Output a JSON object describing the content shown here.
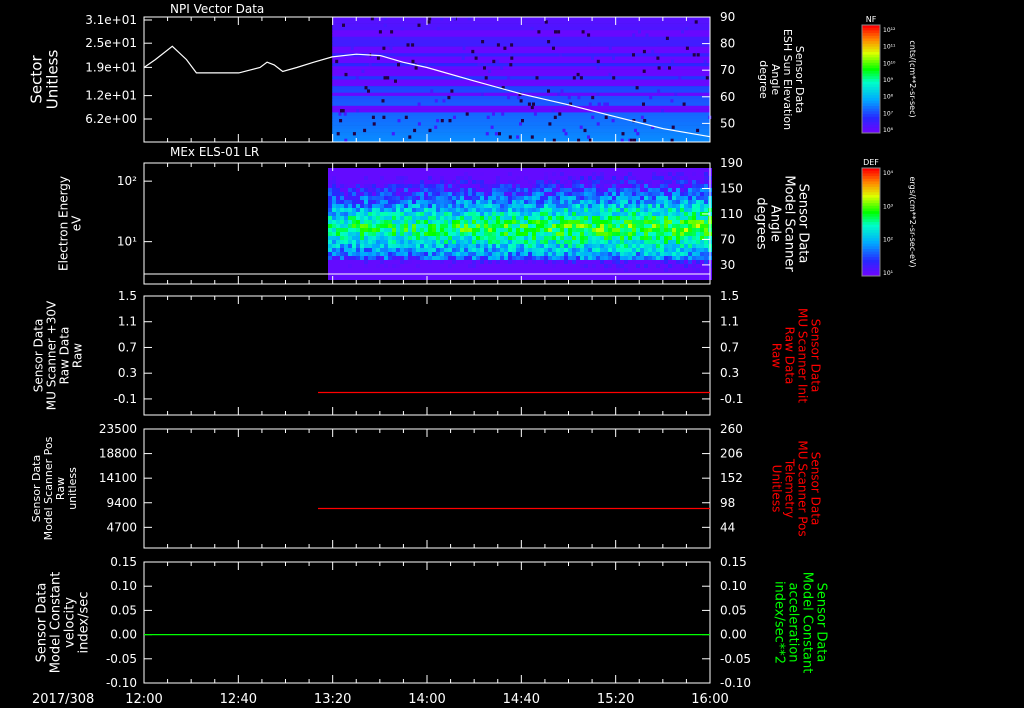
{
  "colors": {
    "background": "#000000",
    "foreground": "#ffffff",
    "red": "#ff0000",
    "green": "#00ff00"
  },
  "time_axis": {
    "date_label": "2017/308",
    "ticks": [
      "12:00",
      "12:40",
      "13:20",
      "14:00",
      "14:40",
      "15:20",
      "16:00"
    ],
    "tick_hours": [
      12.0,
      12.6667,
      13.3333,
      14.0,
      14.6667,
      15.3333,
      16.0
    ]
  },
  "colorbars": [
    {
      "label": "NF",
      "units": "cnts/(cm**2-sr-sec)",
      "tick_labels": [
        "10¹²",
        "10¹¹",
        "10¹⁰",
        "10⁹",
        "10⁸",
        "10⁷",
        "10⁶"
      ]
    },
    {
      "label": "DEF",
      "units": "ergs/(cm**2-sr-sec-eV)",
      "tick_labels": [
        "10⁴",
        "10³",
        "10²",
        "10¹"
      ]
    }
  ],
  "chart_data": [
    {
      "type": "heatmap",
      "title": "NPI Vector Data",
      "ylabel": "Sector\nUnitless",
      "yticks": [
        "3.1e+01",
        "2.5e+01",
        "1.9e+01",
        "1.2e+01",
        "6.2e+00"
      ],
      "ylim": [
        0,
        31
      ],
      "data_start_hour": 13.33,
      "right_ylabel": "Sensor Data\nESH Sun Elevation\nAngle\ndegree",
      "right_yticks": [
        90,
        80,
        70,
        60,
        50
      ],
      "right_ylim": [
        43,
        90
      ],
      "overlay_line": {
        "x_hours": [
          12.0,
          12.08,
          12.2,
          12.3,
          12.37,
          12.47,
          12.67,
          12.82,
          12.87,
          12.92,
          12.98,
          13.08,
          13.2,
          13.33,
          13.5,
          13.67,
          13.83,
          14.0,
          14.33,
          14.67,
          15.0,
          15.33,
          15.67,
          16.0
        ],
        "y": [
          71,
          74,
          79,
          74,
          69,
          69,
          69,
          71,
          73,
          72,
          69.5,
          71,
          73,
          75,
          76,
          75.5,
          73,
          71,
          66,
          61,
          57,
          52.5,
          48,
          45
        ]
      }
    },
    {
      "type": "heatmap",
      "title": "MEx ELS-01 LR",
      "ylabel": "Electron Energy\neV",
      "yticks": [
        "10²",
        "10¹"
      ],
      "y_log_range": [
        0.3,
        2.3
      ],
      "data_start_hour": 13.3,
      "right_ylabel": "Sensor Data\nModel Scanner\nAngle\ndegrees",
      "right_yticks": [
        190,
        150,
        110,
        70,
        30
      ]
    },
    {
      "type": "line",
      "ylabel": "Sensor Data\nMU Scanner +30V\nRaw Data\nRaw",
      "yticks": [
        1.5,
        1.1,
        0.7,
        0.3,
        -0.1
      ],
      "ylim": [
        -0.35,
        1.5
      ],
      "right_ylabel": "Sensor Data\nMU Scanner Init\nRaw Data\nRaw",
      "right_yticks": [
        1.5,
        1.1,
        0.7,
        0.3,
        -0.1
      ],
      "series": [
        {
          "color": "#ff0000",
          "x_hours": [
            13.23,
            16.0
          ],
          "y": [
            0.0,
            0.0
          ]
        }
      ]
    },
    {
      "type": "line",
      "ylabel": "Sensor Data\nModel Scanner Pos\nRaw\nunitless",
      "yticks": [
        23500,
        18800,
        14100,
        9400,
        4700
      ],
      "ylim": [
        750,
        23500
      ],
      "right_ylabel": "Sensor Data\nMU Scanner Pos\nTelemetry\nUnitless",
      "right_yticks": [
        260,
        206,
        152,
        98,
        44
      ],
      "series": [
        {
          "color": "#ff0000",
          "x_hours": [
            13.23,
            16.0
          ],
          "y": [
            8300,
            8300
          ]
        }
      ]
    },
    {
      "type": "line",
      "ylabel": "Sensor Data\nModel Constant\nvelocity\nindex/sec",
      "yticks": [
        "0.15",
        "0.10",
        "0.05",
        "0.00",
        "-0.05",
        "-0.10"
      ],
      "ylim": [
        -0.1,
        0.15
      ],
      "right_ylabel": "Sensor Data\nModel Constant\nacceleration\nindex/sec**2",
      "right_yticks": [
        "0.15",
        "0.10",
        "0.05",
        "0.00",
        "-0.05",
        "-0.10"
      ],
      "series": [
        {
          "color": "#00ff00",
          "x_hours": [
            12.0,
            16.0
          ],
          "y": [
            0.0,
            0.0
          ]
        }
      ]
    }
  ]
}
